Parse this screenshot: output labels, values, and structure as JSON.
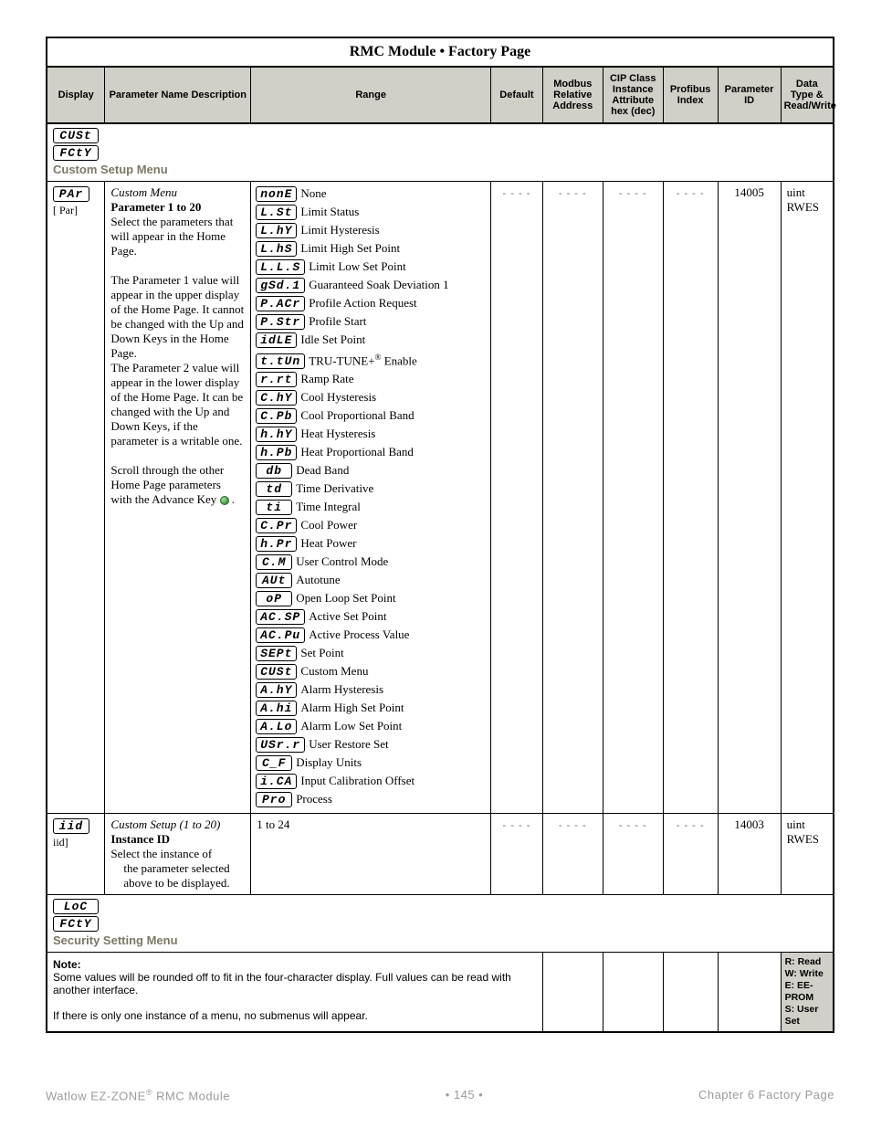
{
  "table_title": "RMC Module  •  Factory Page",
  "headers": {
    "display": "Display",
    "desc": "Parameter Name Description",
    "range": "Range",
    "default": "Default",
    "modbus": "Modbus Relative Address",
    "cip": "CIP Class Instance Attribute hex (dec)",
    "profibus": "Profibus Index",
    "param": "Parameter ID",
    "dtype": "Data Type & Read/Write"
  },
  "section1": {
    "seg1": "CUSt",
    "seg2": "FCtY",
    "label": "Custom Setup Menu"
  },
  "row1": {
    "seg": "PAr",
    "sublabel": "[ Par]",
    "desc_title": "Custom Menu",
    "desc_bold": "Parameter 1 to 20",
    "desc_p1": "Select the parameters that will appear in the Home Page.",
    "desc_p2": "The Parameter 1 value will appear in the upper display of the Home Page. It cannot be changed with the Up and Down Keys in the Home Page.",
    "desc_p3": "The Parameter 2 value will appear in the lower display of the Home Page. It can be changed with the Up and Down Keys, if the parameter is a writable one.",
    "desc_p4a": "Scroll through the other Home Page parameters with the Advance Key ",
    "desc_p4b": " .",
    "default": "- - - -",
    "modbus": "- - - -",
    "cip": "- - - -",
    "profibus": "- - - -",
    "param": "14005",
    "dtype1": "uint",
    "dtype2": "RWES",
    "ranges": [
      {
        "seg": "nonE",
        "txt": "None"
      },
      {
        "seg": "L.St",
        "txt": "Limit Status"
      },
      {
        "seg": "L.hY",
        "txt": "Limit Hysteresis"
      },
      {
        "seg": "L.hS",
        "txt": "Limit High Set Point"
      },
      {
        "seg": "L.L.S",
        "txt": "Limit Low Set Point"
      },
      {
        "seg": "gSd.1",
        "txt": "Guaranteed Soak Deviation 1"
      },
      {
        "seg": "P.ACr",
        "txt": "Profile Action Request"
      },
      {
        "seg": "P.Str",
        "txt": "Profile Start"
      },
      {
        "seg": "idLE",
        "txt": "Idle Set Point"
      },
      {
        "seg": "t.tUn",
        "txt": "TRU-TUNE+® Enable"
      },
      {
        "seg": "r.rt",
        "txt": "Ramp Rate"
      },
      {
        "seg": "C.hY",
        "txt": "Cool Hysteresis"
      },
      {
        "seg": "C.Pb",
        "txt": "Cool Proportional Band"
      },
      {
        "seg": "h.hY",
        "txt": "Heat Hysteresis"
      },
      {
        "seg": "h.Pb",
        "txt": "Heat Proportional Band"
      },
      {
        "seg": "db",
        "txt": "Dead Band"
      },
      {
        "seg": "td",
        "txt": "Time Derivative"
      },
      {
        "seg": "ti",
        "txt": "Time Integral"
      },
      {
        "seg": "C.Pr",
        "txt": "Cool Power"
      },
      {
        "seg": "h.Pr",
        "txt": "Heat Power"
      },
      {
        "seg": "C.M",
        "txt": "User Control Mode"
      },
      {
        "seg": "AUt",
        "txt": "Autotune"
      },
      {
        "seg": "oP",
        "txt": "Open Loop Set Point"
      },
      {
        "seg": "AC.SP",
        "txt": "Active Set Point"
      },
      {
        "seg": "AC.Pu",
        "txt": "Active Process Value"
      },
      {
        "seg": "SEPt",
        "txt": "Set Point"
      },
      {
        "seg": "CUSt",
        "txt": "Custom Menu"
      },
      {
        "seg": "A.hY",
        "txt": "Alarm Hysteresis"
      },
      {
        "seg": "A.hi",
        "txt": "Alarm High Set Point"
      },
      {
        "seg": "A.Lo",
        "txt": "Alarm Low Set Point"
      },
      {
        "seg": "USr.r",
        "txt": "User Restore Set"
      },
      {
        "seg": "C_F",
        "txt": "Display Units"
      },
      {
        "seg": "i.CA",
        "txt": "Input Calibration Offset"
      },
      {
        "seg": "Pro",
        "txt": "Process"
      }
    ]
  },
  "row2": {
    "seg": "iid",
    "sublabel": "iid]",
    "desc_title": "Custom Setup (1 to 20)",
    "desc_bold": "Instance ID",
    "desc_p1": "Select the instance of the parameter selected above to be displayed.",
    "range": "1 to 24",
    "default": "- - - -",
    "modbus": "- - - -",
    "cip": "- - - -",
    "profibus": "- - - -",
    "param": "14003",
    "dtype1": "uint",
    "dtype2": "RWES"
  },
  "section2": {
    "seg1": "LoC",
    "seg2": "FCtY",
    "label": "Security Setting Menu"
  },
  "note": {
    "title": "Note:",
    "line1": "Some values will be rounded off to fit in the four-character display. Full values can be read with another interface.",
    "line2": "If there is only one instance of a menu, no submenus will appear.",
    "legend": "R: Read\nW: Write\nE: EE-PROM\nS: User Set"
  },
  "footer": {
    "left": "Watlow EZ-ZONE® RMC Module",
    "mid": "•  145  •",
    "right": "Chapter 6 Factory Page"
  }
}
